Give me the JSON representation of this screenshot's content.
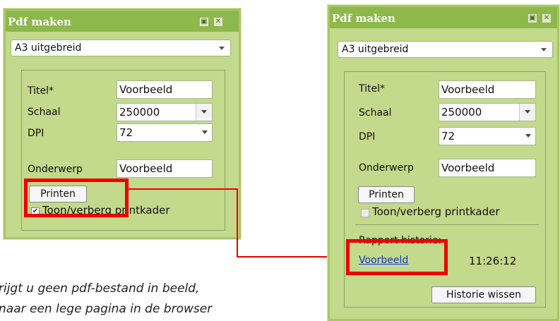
{
  "left_panel": {
    "title": "Pdf maken",
    "format_select": "A3 uitgebreid",
    "fields": {
      "titel_label": "Titel*",
      "titel_value": "Voorbeeld",
      "schaal_label": "Schaal",
      "schaal_value": "250000",
      "dpi_label": "DPI",
      "dpi_value": "72",
      "onderwerp_label": "Onderwerp",
      "onderwerp_value": "Voorbeeld"
    },
    "print_button": "Printen",
    "toggle_label": "Toon/verberg printkader",
    "toggle_checked": true
  },
  "right_panel": {
    "title": "Pdf maken",
    "format_select": "A3 uitgebreid",
    "fields": {
      "titel_label": "Titel*",
      "titel_value": "Voorbeeld",
      "schaal_label": "Schaal",
      "schaal_value": "250000",
      "dpi_label": "DPI",
      "dpi_value": "72",
      "onderwerp_label": "Onderwerp",
      "onderwerp_value": "Voorbeeld"
    },
    "print_button": "Printen",
    "toggle_label": "Toon/verberg printkader",
    "toggle_checked": false,
    "history_label": "Rapport historie:",
    "history_link": "Voorbeeld",
    "history_time": "11:26:12",
    "clear_history_button": "Historie wissen"
  },
  "caption": {
    "line1": "rijgt u geen pdf-bestand in beeld,",
    "line2": "naar een lege pagina in de browser"
  },
  "colors": {
    "panel_bg": "#c3d98b",
    "titlebar": "#8db84a",
    "highlight": "#ee0000",
    "link": "#1a33cc"
  }
}
